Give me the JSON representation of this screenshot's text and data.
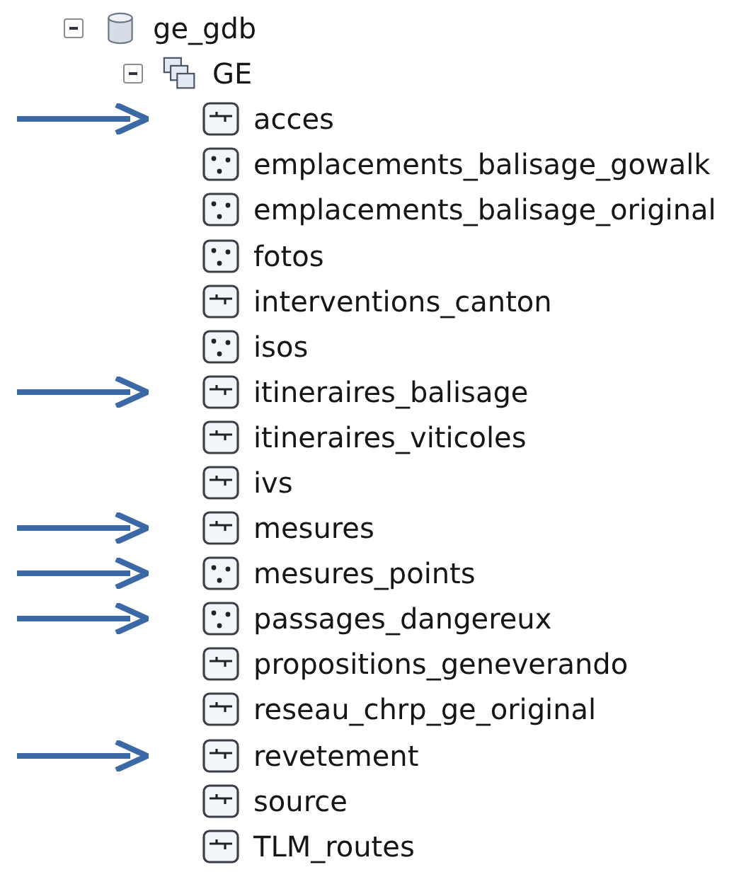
{
  "tree": [
    {
      "label": "ge_gdb",
      "kind": "database",
      "expanded": true,
      "children": [
        {
          "label": "GE",
          "kind": "dataset",
          "expanded": true,
          "children": [
            {
              "label": "acces",
              "kind": "line",
              "marked": true
            },
            {
              "label": "emplacements_balisage_gowalk",
              "kind": "point",
              "marked": false
            },
            {
              "label": "emplacements_balisage_original",
              "kind": "point",
              "marked": false
            },
            {
              "label": "fotos",
              "kind": "point",
              "marked": false
            },
            {
              "label": "interventions_canton",
              "kind": "line",
              "marked": false
            },
            {
              "label": "isos",
              "kind": "point",
              "marked": false
            },
            {
              "label": "itineraires_balisage",
              "kind": "line",
              "marked": true
            },
            {
              "label": "itineraires_viticoles",
              "kind": "line",
              "marked": false
            },
            {
              "label": "ivs",
              "kind": "line",
              "marked": false
            },
            {
              "label": "mesures",
              "kind": "line",
              "marked": true
            },
            {
              "label": "mesures_points",
              "kind": "point",
              "marked": true
            },
            {
              "label": "passages_dangereux",
              "kind": "point",
              "marked": true
            },
            {
              "label": "propositions_geneverando",
              "kind": "line",
              "marked": false
            },
            {
              "label": "reseau_chrp_ge_original",
              "kind": "line",
              "marked": false
            },
            {
              "label": "revetement",
              "kind": "line",
              "marked": true
            },
            {
              "label": "source",
              "kind": "line",
              "marked": false
            },
            {
              "label": "TLM_routes",
              "kind": "line",
              "marked": false
            }
          ]
        }
      ]
    }
  ]
}
